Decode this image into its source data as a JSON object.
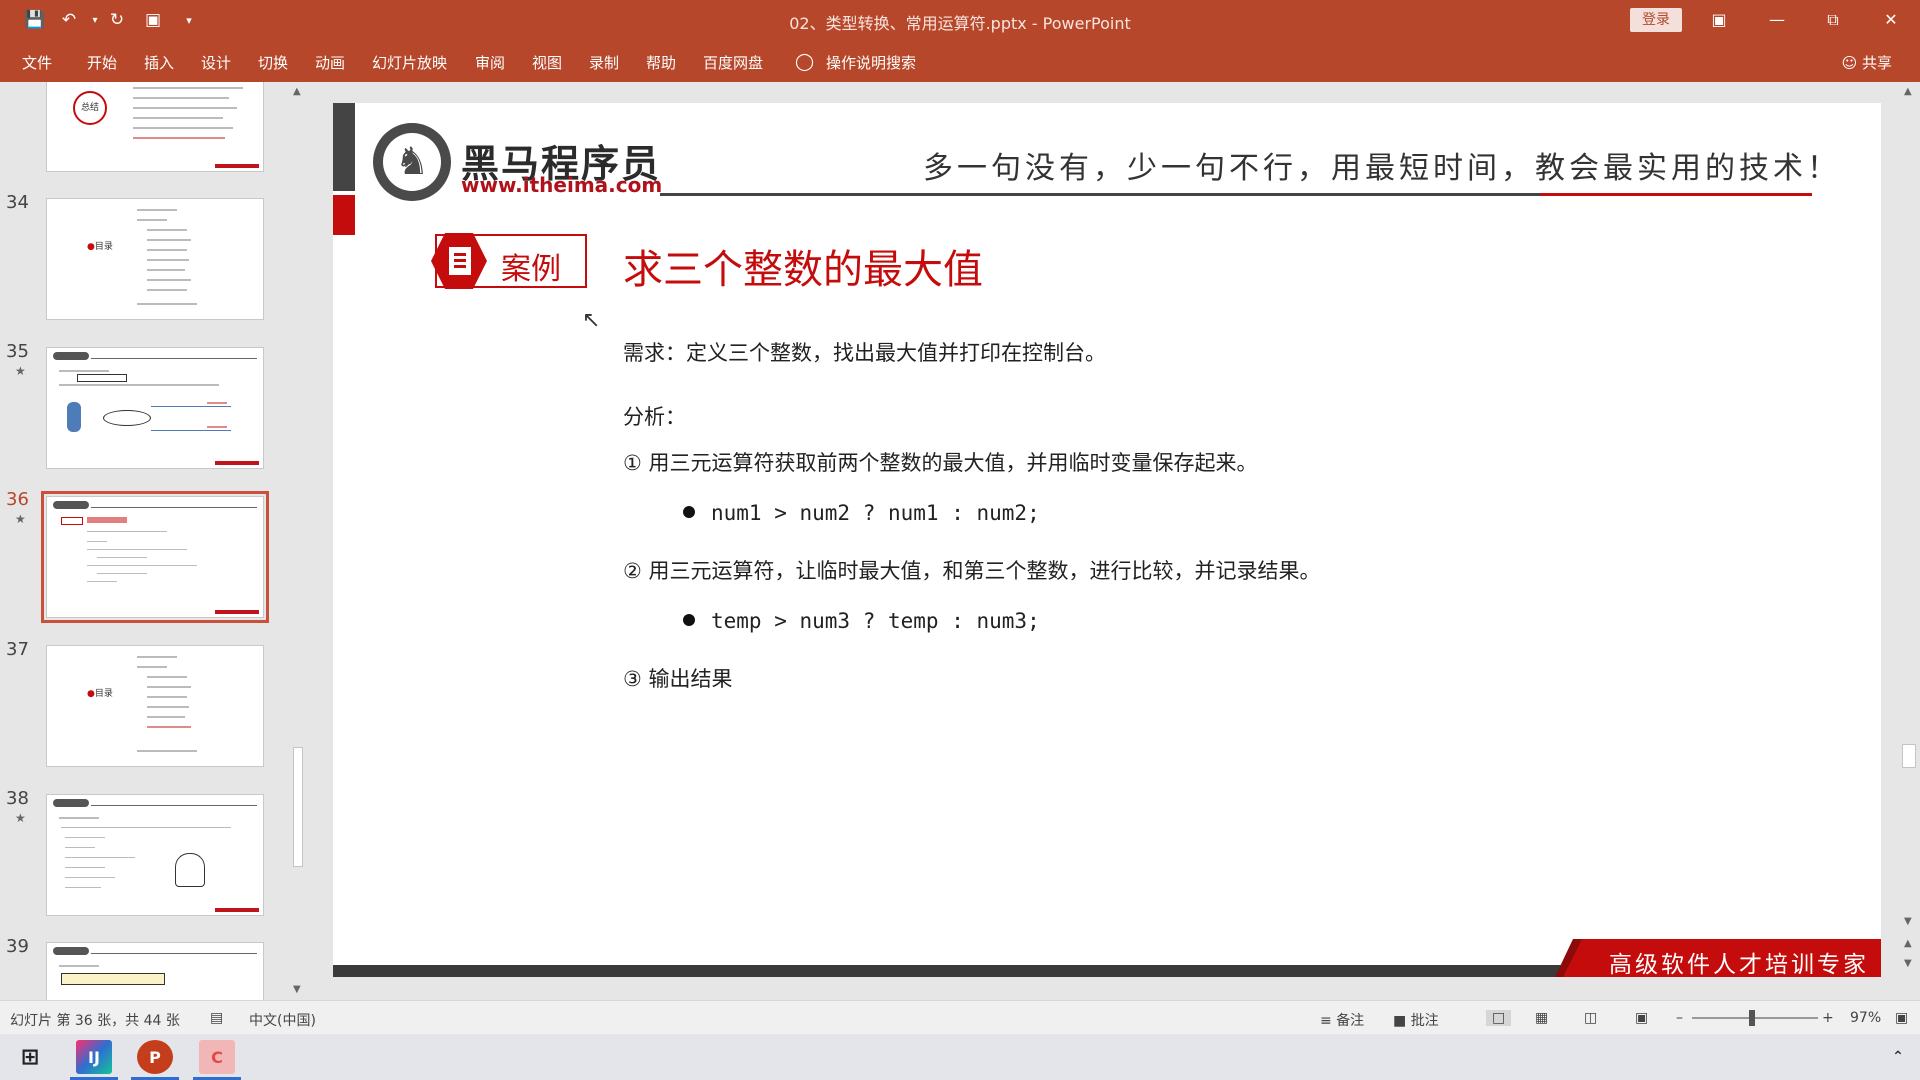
{
  "titlebar": {
    "doc_title": "02、类型转换、常用运算符.pptx  -  PowerPoint",
    "login": "登录",
    "quick_access": [
      "save-icon",
      "undo-icon",
      "redo-icon",
      "present-icon",
      "customize-icon"
    ]
  },
  "ribbon": {
    "tabs": [
      "文件",
      "开始",
      "插入",
      "设计",
      "切换",
      "动画",
      "幻灯片放映",
      "审阅",
      "视图",
      "录制",
      "帮助",
      "百度网盘"
    ],
    "search": "操作说明搜索",
    "share": "共享"
  },
  "thumbnails": [
    {
      "num": "34",
      "star": false
    },
    {
      "num": "35",
      "star": true
    },
    {
      "num": "36",
      "star": true,
      "selected": true
    },
    {
      "num": "37",
      "star": false
    },
    {
      "num": "38",
      "star": true
    },
    {
      "num": "39",
      "star": false
    }
  ],
  "thumb_labels": {
    "summary": "总结",
    "toc": "目录"
  },
  "slide": {
    "brand_name": "黑马程序员",
    "brand_url": "www.itheima.com",
    "slogan": "多一句没有，少一句不行，用最短时间，教会最实用的技术！",
    "case_label": "案例",
    "title": "求三个整数的最大值",
    "requirement": "需求：定义三个整数，找出最大值并打印在控制台。",
    "analysis": "分析：",
    "step1": "① 用三元运算符获取前两个整数的最大值，并用临时变量保存起来。",
    "code1": "num1 > num2 ? num1 : num2;",
    "step2": "② 用三元运算符，让临时最大值，和第三个整数，进行比较，并记录结果。",
    "code2": "temp > num3 ? temp : num3;",
    "step3": "③ 输出结果",
    "footer": "高级软件人才培训专家"
  },
  "statusbar": {
    "slide_info": "幻灯片 第 36 张，共 44 张",
    "language": "中文(中国)",
    "notes": "备注",
    "comments": "批注",
    "zoom": "97%"
  },
  "colors": {
    "ribbon": "#b7472a",
    "accent_red": "#c40c0c"
  }
}
